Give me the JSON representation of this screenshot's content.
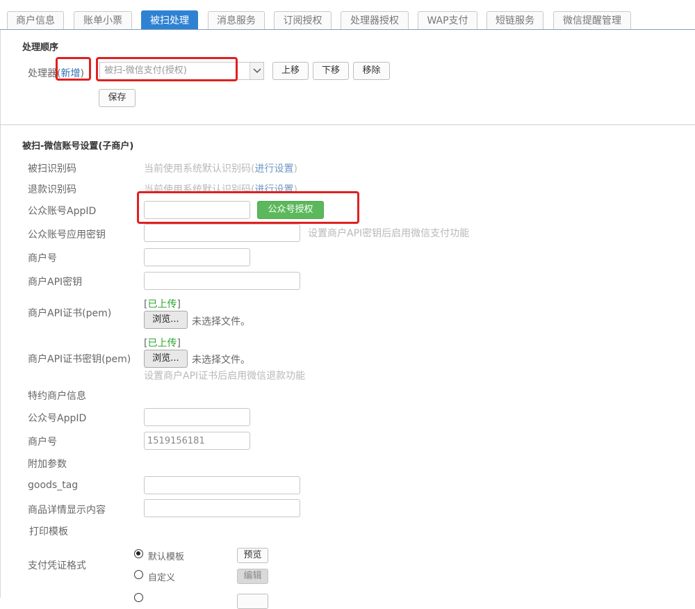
{
  "tabs": [
    {
      "label": "商户信息",
      "active": false
    },
    {
      "label": "账单小票",
      "active": false
    },
    {
      "label": "被扫处理",
      "active": true
    },
    {
      "label": "消息服务",
      "active": false
    },
    {
      "label": "订阅授权",
      "active": false
    },
    {
      "label": "处理器授权",
      "active": false
    },
    {
      "label": "WAP支付",
      "active": false
    },
    {
      "label": "短链服务",
      "active": false
    },
    {
      "label": "微信提醒管理",
      "active": false
    }
  ],
  "order": {
    "heading": "处理顺序",
    "processor_label": "处理器",
    "add_link": "新增",
    "paren_open": "(",
    "paren_close": ")",
    "processor_selected": "被扫-微信支付(授权)",
    "move_up": "上移",
    "move_down": "下移",
    "remove": "移除",
    "save": "保存"
  },
  "wechat": {
    "heading": "被扫-微信账号设置(子商户)",
    "scan_code_label": "被扫识别码",
    "scan_code_hint": "当前使用系统默认识别码",
    "scan_code_link": "进行设置",
    "refund_code_label": "退款识别码",
    "refund_code_hint": "当前使用系统默认识别码",
    "refund_code_link": "进行设置",
    "appid_label": "公众账号AppID",
    "appid_value": "",
    "authorize_button": "公众号授权",
    "app_secret_label": "公众账号应用密钥",
    "app_secret_hint": "设置商户API密钥后启用微信支付功能",
    "merchant_no_label": "商户号",
    "api_key_label": "商户API密钥",
    "cert_label": "商户API证书(pem)",
    "cert_status": "已上传",
    "browse_button": "浏览...",
    "no_file": "未选择文件。",
    "cert_key_label": "商户API证书密钥(pem)",
    "cert_key_status": "已上传",
    "cert_key_hint": "设置商户API证书后启用微信退款功能",
    "special_heading": "特约商户信息",
    "special_appid_label": "公众号AppID",
    "special_merchant_label": "商户号",
    "special_merchant_value": "1519156181",
    "extra_heading": "附加参数",
    "goods_tag_label": "goods_tag",
    "detail_label": "商品详情显示内容",
    "print_heading": "打印模板",
    "voucher_label": "支付凭证格式",
    "default_template": "默认模板",
    "custom_template": "自定义",
    "preview_button": "预览",
    "edit_button": "编辑"
  }
}
